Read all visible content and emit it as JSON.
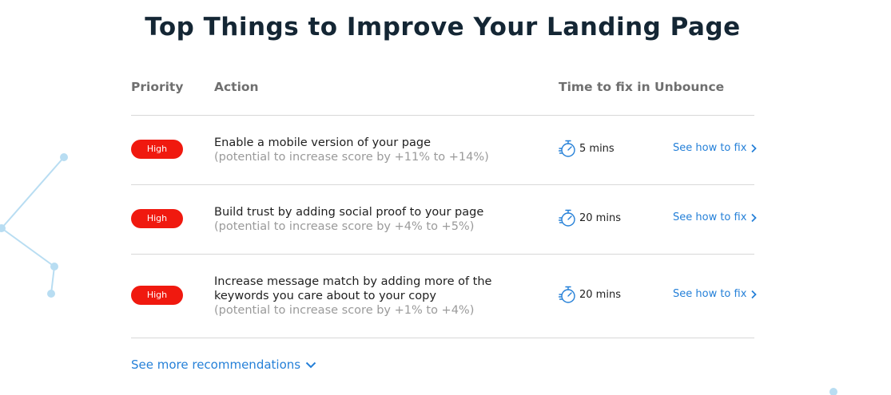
{
  "page": {
    "title": "Top Things to Improve Your Landing Page"
  },
  "table": {
    "headers": {
      "priority": "Priority",
      "action": "Action",
      "time": "Time to fix in Unbounce"
    },
    "rows": [
      {
        "priority": "High",
        "action": "Enable a mobile version of your page",
        "potential": "(potential to increase score by +11% to +14%)",
        "time": "5 mins",
        "fix_label": "See how to fix"
      },
      {
        "priority": "High",
        "action": "Build trust by adding social proof to your page",
        "potential": "(potential to increase score by +4% to +5%)",
        "time": "20 mins",
        "fix_label": "See how to fix"
      },
      {
        "priority": "High",
        "action": "Increase message match by adding more of the keywords you care about to your copy",
        "potential": "(potential to increase score by +1% to +4%)",
        "time": "20 mins",
        "fix_label": "See how to fix"
      }
    ]
  },
  "more_link": "See more recommendations",
  "colors": {
    "badge_high": "#f0190f",
    "link": "#2580d8",
    "title": "#142634",
    "decoration": "#b8ddf2"
  },
  "icons": {
    "time": "stopwatch-icon",
    "fix": "chevron-right-icon",
    "more": "chevron-down-icon"
  }
}
